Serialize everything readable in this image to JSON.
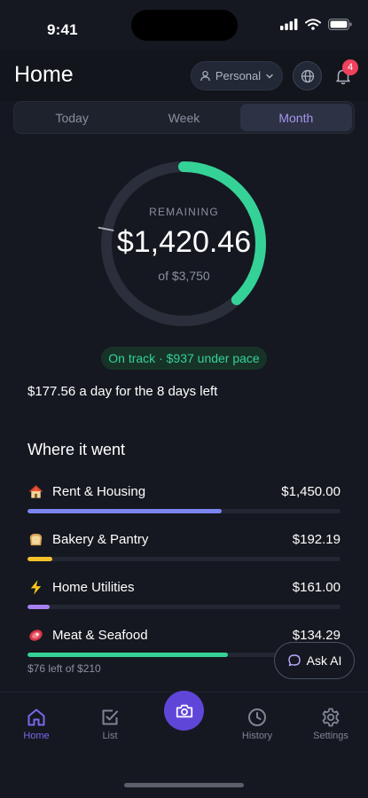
{
  "status_bar": {
    "time": "9:41"
  },
  "header": {
    "title": "Home",
    "profile_label": "Personal",
    "notification_count": "4"
  },
  "segmented": {
    "tabs": [
      {
        "label": "Today",
        "active": false
      },
      {
        "label": "Week",
        "active": false
      },
      {
        "label": "Month",
        "active": true
      }
    ]
  },
  "budget": {
    "remaining_label": "REMAINING",
    "remaining_amount": "$1,420.46",
    "total_label": "of $3,750",
    "remaining_fraction": 0.379,
    "pace_marker_fraction": 0.78,
    "ring_color": "#35d297",
    "status_text": "On track · $937 under pace",
    "daily_text": "$177.56 a day for the 8 days left"
  },
  "section_title": "Where it went",
  "categories": [
    {
      "icon": "house-emoji",
      "name": "Rent & Housing",
      "amount": "$1,450.00",
      "fill": 0.62,
      "color": "#7b85f0"
    },
    {
      "icon": "bread-emoji",
      "name": "Bakery & Pantry",
      "amount": "$192.19",
      "fill": 0.08,
      "color": "#f4c02b"
    },
    {
      "icon": "lightning-emoji",
      "name": "Home Utilities",
      "amount": "$161.00",
      "fill": 0.07,
      "color": "#a67ff0"
    },
    {
      "icon": "meat-emoji",
      "name": "Meat & Seafood",
      "amount": "$134.29",
      "fill": 0.64,
      "color": "#35d297",
      "sub": "$76 left of $210"
    }
  ],
  "ask_ai_label": "Ask AI",
  "tabbar": {
    "items": [
      {
        "label": "Home",
        "icon": "home-icon",
        "active": true
      },
      {
        "label": "List",
        "icon": "checklist-icon",
        "active": false
      },
      {
        "label": "History",
        "icon": "clock-icon",
        "active": false
      },
      {
        "label": "Settings",
        "icon": "gear-icon",
        "active": false
      }
    ],
    "camera_icon": "camera-icon"
  }
}
